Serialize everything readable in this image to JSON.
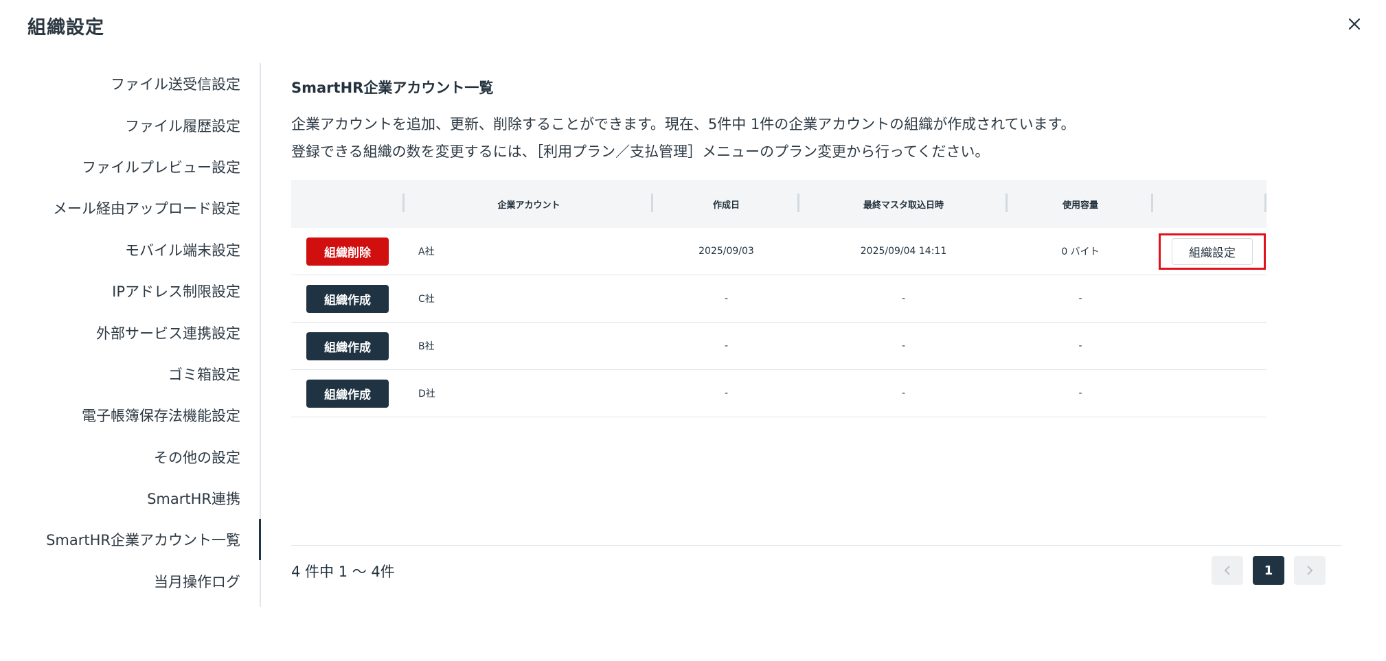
{
  "modal": {
    "title": "組織設定"
  },
  "sidebar": {
    "items": [
      {
        "label": "ファイル送受信設定"
      },
      {
        "label": "ファイル履歴設定"
      },
      {
        "label": "ファイルプレビュー設定"
      },
      {
        "label": "メール経由アップロード設定"
      },
      {
        "label": "モバイル端末設定"
      },
      {
        "label": "IPアドレス制限設定"
      },
      {
        "label": "外部サービス連携設定"
      },
      {
        "label": "ゴミ箱設定"
      },
      {
        "label": "電子帳簿保存法機能設定"
      },
      {
        "label": "その他の設定"
      },
      {
        "label": "SmartHR連携"
      },
      {
        "label": "SmartHR企業アカウント一覧",
        "active": true
      },
      {
        "label": "当月操作ログ"
      }
    ]
  },
  "main": {
    "title": "SmartHR企業アカウント一覧",
    "description_line1": "企業アカウントを追加、更新、削除することができます。現在、5件中 1件の企業アカウントの組織が作成されています。",
    "description_line2": "登録できる組織の数を変更するには、［利用プラン／支払管理］メニューのプラン変更から行ってください。"
  },
  "table": {
    "headers": [
      "",
      "企業アカウント",
      "作成日",
      "最終マスタ取込日時",
      "使用容量",
      ""
    ],
    "rows": [
      {
        "action": "組織削除",
        "account": "A社",
        "created": "2025/09/03",
        "last_import": "2025/09/04 14:11",
        "usage": "0 バイト",
        "settings": "組織設定"
      },
      {
        "action": "組織作成",
        "account": "C社",
        "created": "-",
        "last_import": "-",
        "usage": "-"
      },
      {
        "action": "組織作成",
        "account": "B社",
        "created": "-",
        "last_import": "-",
        "usage": "-"
      },
      {
        "action": "組織作成",
        "account": "D社",
        "created": "-",
        "last_import": "-",
        "usage": "-"
      }
    ]
  },
  "pagination": {
    "summary": "4 件中  1 ～ 4件",
    "current_page": "1",
    "prev_icon": "chevron-left-icon",
    "next_icon": "chevron-right-icon"
  },
  "colors": {
    "primary_dark": "#1f3342",
    "danger": "#d10f0f",
    "highlight": "#e2101a"
  }
}
